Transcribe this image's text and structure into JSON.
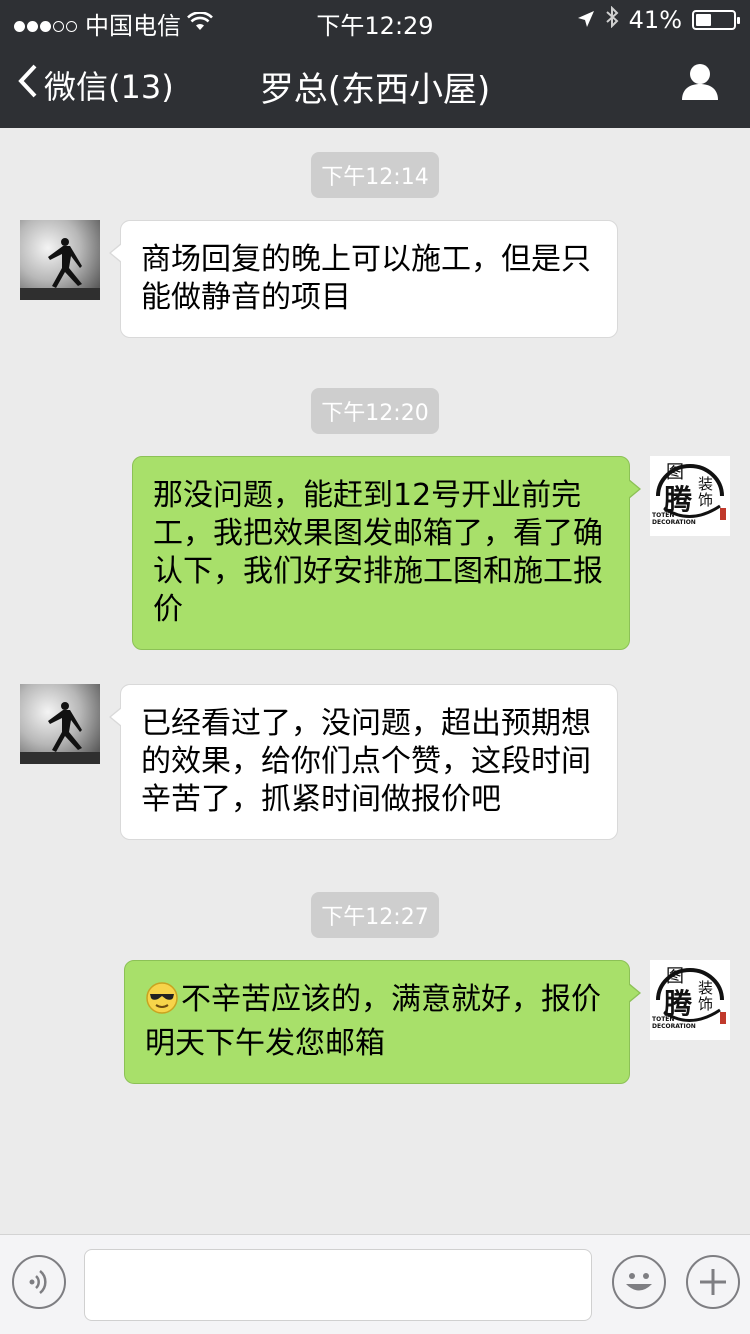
{
  "status_bar": {
    "carrier": "中国电信",
    "time": "下午12:29",
    "battery": "41%",
    "battery_level": 0.41
  },
  "nav": {
    "back_label": "微信(13)",
    "title": "罗总(东西小屋)",
    "profile_icon": "person-icon"
  },
  "messages": [
    {
      "type": "time",
      "text": "下午12:14"
    },
    {
      "type": "incoming",
      "text": "商场回复的晚上可以施工，但是只能做静音的项目"
    },
    {
      "type": "time",
      "text": "下午12:20"
    },
    {
      "type": "outgoing",
      "text": "那没问题，能赶到12号开业前完工，我把效果图发邮箱了，看了确认下，我们好安排施工图和施工报价"
    },
    {
      "type": "incoming",
      "text": "已经看过了，没问题，超出预期想的效果，给你们点个赞，这段时间辛苦了，抓紧时间做报价吧"
    },
    {
      "type": "time",
      "text": "下午12:27"
    },
    {
      "type": "outgoing",
      "emoji": "cool-emoji",
      "text": "不辛苦应该的，满意就好，报价明天下午发您邮箱"
    }
  ],
  "own_avatar": {
    "logo_main": "腾",
    "logo_top": "图",
    "logo_side": "装饰",
    "logo_caption": "TOTEN DECORATION"
  },
  "input_bar": {
    "voice_icon": "voice-icon",
    "input_value": "",
    "emoji_icon": "emoji-icon",
    "plus_icon": "plus-icon"
  },
  "colors": {
    "bar_bg": "#2e3034",
    "chat_bg": "#ebebeb",
    "outgoing_bubble": "#a8e06a",
    "incoming_bubble": "#ffffff",
    "time_pill": "#cecece"
  }
}
